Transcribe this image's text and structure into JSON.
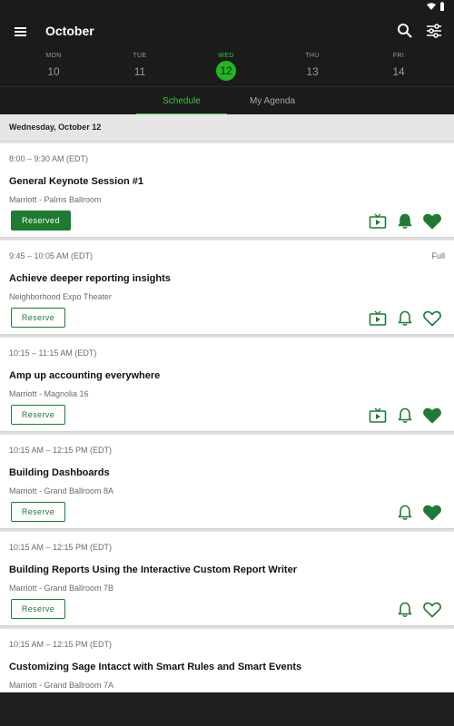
{
  "colors": {
    "accent": "#23b523",
    "brand_green": "#1f7a32",
    "dark_bar": "#1b1b1b"
  },
  "header": {
    "title": "October",
    "icons": [
      "menu-icon",
      "search-icon",
      "filter-sliders-icon"
    ]
  },
  "days": [
    {
      "dow": "MON",
      "num": "10"
    },
    {
      "dow": "TUE",
      "num": "11"
    },
    {
      "dow": "WED",
      "num": "12"
    },
    {
      "dow": "THU",
      "num": "13"
    },
    {
      "dow": "FRI",
      "num": "14"
    }
  ],
  "selected_day": "WED 12",
  "tabs": {
    "schedule": "Schedule",
    "agenda": "My Agenda",
    "active": "Schedule"
  },
  "day_header": "Wednesday, October 12",
  "sessions": [
    {
      "time": "8:00 – 9:30 AM (EDT)",
      "status": "",
      "title": "General Keynote Session #1",
      "location": "Marriott - Palms Ballroom",
      "button": "Reserved",
      "reserved": true,
      "has_video": true,
      "bell_filled": true,
      "heart_filled": true
    },
    {
      "time": "9:45 – 10:05 AM (EDT)",
      "status": "Full",
      "title": "Achieve deeper reporting insights",
      "location": "Neighborhood Expo Theater",
      "button": "Reserve",
      "reserved": false,
      "has_video": true,
      "bell_filled": false,
      "heart_filled": false
    },
    {
      "time": "10:15 – 11:15 AM (EDT)",
      "status": "",
      "title": "Amp up accounting everywhere",
      "location": "Marriott - Magnolia 16",
      "button": "Reserve",
      "reserved": false,
      "has_video": true,
      "bell_filled": false,
      "heart_filled": true
    },
    {
      "time": "10:15 AM – 12:15 PM (EDT)",
      "status": "",
      "title": "Building Dashboards",
      "location": "Marriott - Grand Ballroom 8A",
      "button": "Reserve",
      "reserved": false,
      "has_video": false,
      "bell_filled": false,
      "heart_filled": true
    },
    {
      "time": "10:15 AM – 12:15 PM (EDT)",
      "status": "",
      "title": "Building Reports Using the Interactive Custom Report Writer",
      "location": "Marriott - Grand Ballroom 7B",
      "button": "Reserve",
      "reserved": false,
      "has_video": false,
      "bell_filled": false,
      "heart_filled": false
    },
    {
      "time": "10:15 AM – 12:15 PM (EDT)",
      "status": "",
      "title": "Customizing Sage Intacct with Smart Rules and Smart Events",
      "location": "Marriott - Grand Ballroom 7A",
      "button": "",
      "reserved": false,
      "has_video": false,
      "bell_filled": false,
      "heart_filled": false
    }
  ]
}
